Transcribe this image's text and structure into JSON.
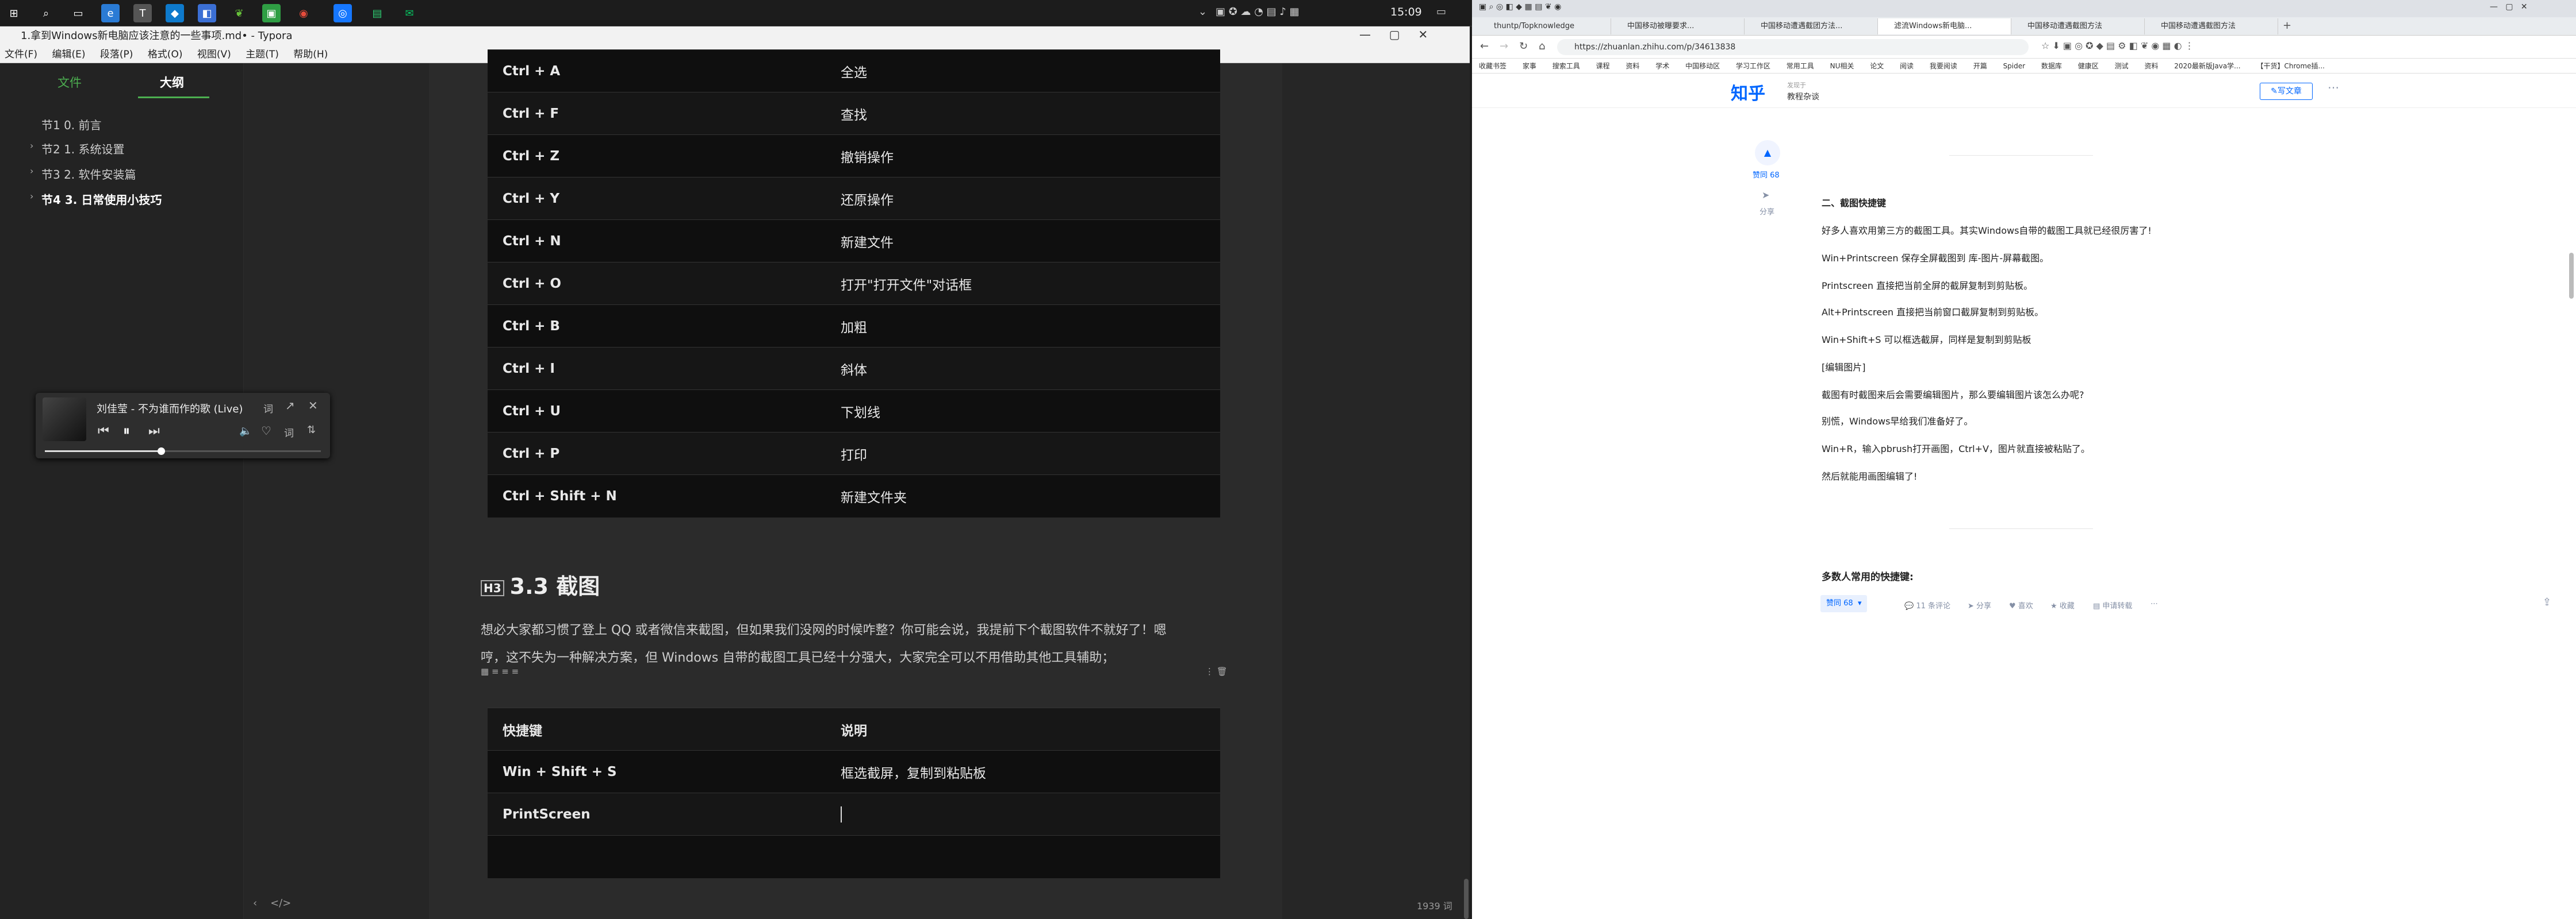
{
  "taskbar": {
    "time": "15:09"
  },
  "typora": {
    "title": "1.拿到Windows新电脑应该注意的一些事项.md• - Typora",
    "menu": [
      "文件(F)",
      "编辑(E)",
      "段落(P)",
      "格式(O)",
      "视图(V)",
      "主题(T)",
      "帮助(H)"
    ],
    "tabs": {
      "files": "文件",
      "outline": "大纲"
    },
    "toc": [
      "节1 0. 前言",
      "节2 1. 系统设置",
      "节3 2. 软件安装篇",
      "节4 3. 日常使用小技巧"
    ],
    "shortcuts": [
      [
        "Ctrl + A",
        "全选"
      ],
      [
        "Ctrl + F",
        "查找"
      ],
      [
        "Ctrl + Z",
        "撤销操作"
      ],
      [
        "Ctrl + Y",
        "还原操作"
      ],
      [
        "Ctrl + N",
        "新建文件"
      ],
      [
        "Ctrl + O",
        "打开\"打开文件\"对话框"
      ],
      [
        "Ctrl + B",
        "加粗"
      ],
      [
        "Ctrl + I",
        "斜体"
      ],
      [
        "Ctrl + U",
        "下划线"
      ],
      [
        "Ctrl + P",
        "打印"
      ],
      [
        "Ctrl + Shift + N",
        "新建文件夹"
      ]
    ],
    "h3": "3.3 截图",
    "para1": "想必大家都习惯了登上 QQ 或者微信来截图，但如果我们没网的时候咋整？你可能会说，我提前下个截图软件不就好了！嗯",
    "para2": "哼，这不失为一种解决方案，但 Windows 自带的截图工具已经十分强大，大家完全可以不用借助其他工具辅助；",
    "table2": {
      "headers": [
        "快捷键",
        "说明"
      ],
      "rows": [
        [
          "Win + Shift + S",
          "框选截屏，复制到粘贴板"
        ],
        [
          "PrintScreen",
          ""
        ],
        [
          "",
          ""
        ]
      ]
    },
    "word_count": "1939 词"
  },
  "music": {
    "title": "刘佳莹 - 不为谁而作的歌 (Live)",
    "lyric": "词",
    "sort": "词"
  },
  "browser": {
    "tabs": [
      "thuntp/Topknowledge",
      "中国移动被曝要求...",
      "中国移动遭遇截团方法...",
      "滤流Windows新电脑...",
      "中国移动遭遇截图方法",
      "中国移动遭遇截图方法"
    ],
    "url": "https://zhuanlan.zhihu.com/p/34613838",
    "bookmarks": [
      "收藏书签",
      "家事",
      "搜索工具",
      "课程",
      "资料",
      "学术",
      "中国移动区",
      "学习工作区",
      "常用工具",
      "NU相关",
      "论文",
      "阅读",
      "我要阅读",
      "开篇",
      "Spider",
      "数据库",
      "健康区",
      "测试",
      "资料",
      "2020最新版Java学...",
      "【干货】Chrome插..."
    ],
    "zhihu_logo": "知乎",
    "column_small": "发现于",
    "column_name": "教程杂谈",
    "write_btn": "写文章",
    "upvote_side": "赞同 68",
    "share_side": "分享",
    "article_lines": [
      "二、截图快捷键",
      "好多人喜欢用第三方的截图工具。其实Windows自带的截图工具就已经很厉害了!",
      "Win+Printscreen 保存全屏截图到 库-图片-屏幕截图。",
      "Printscreen 直接把当前全屏的截屏复制到剪贴板。",
      "Alt+Printscreen 直接把当前窗口截屏复制到剪贴板。",
      "Win+Shift+S 可以框选截屏，同样是复制到剪贴板",
      "[编辑图片]",
      "截图有时截图来后会需要编辑图片，那么要编辑图片该怎么办呢?",
      "别慌，Windows早给我们准备好了。",
      "Win+R，输入pbrush打开画图，Ctrl+V，图片就直接被粘贴了。",
      "然后就能用画图编辑了!"
    ],
    "section2": "多数人常用的快捷键:",
    "actions": [
      "赞同 68",
      "11 条评论",
      "分享",
      "喜欢",
      "收藏",
      "申请转载"
    ]
  }
}
